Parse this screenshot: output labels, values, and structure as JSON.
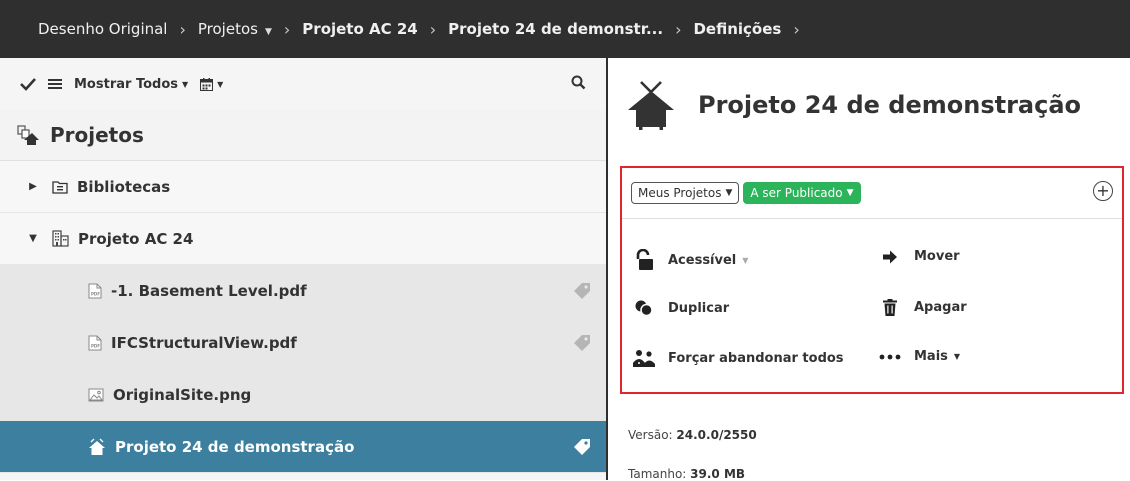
{
  "breadcrumb": {
    "items": [
      "Desenho Original",
      "Projetos",
      "Projeto AC 24",
      "Projeto 24 de demonstr...",
      "Definições"
    ]
  },
  "toolbar": {
    "show_all_label": "Mostrar Todos"
  },
  "tree": {
    "header": "Projetos",
    "items": [
      {
        "label": "Bibliotecas"
      },
      {
        "label": "Projeto AC 24"
      },
      {
        "label": "-1. Basement Level.pdf"
      },
      {
        "label": "IFCStructuralView.pdf"
      },
      {
        "label": "OriginalSite.png"
      },
      {
        "label": "Projeto 24 de demonstração"
      }
    ]
  },
  "detail": {
    "title": "Projeto 24 de demonstração",
    "filters": {
      "scope": "Meus Projetos",
      "status": "A ser Publicado"
    },
    "actions": {
      "accessible": "Acessível",
      "move": "Mover",
      "duplicate": "Duplicar",
      "delete": "Apagar",
      "force_release": "Forçar abandonar todos",
      "more": "Mais"
    },
    "version_label": "Versão:",
    "version_value": "24.0.0/2550",
    "size_label": "Tamanho:",
    "size_value": "39.0 MB"
  },
  "colors": {
    "topbar": "#2f2f2f",
    "selected_row": "#3d7f9e",
    "status_green": "#2bb45a",
    "highlight_border": "#e1252c"
  }
}
